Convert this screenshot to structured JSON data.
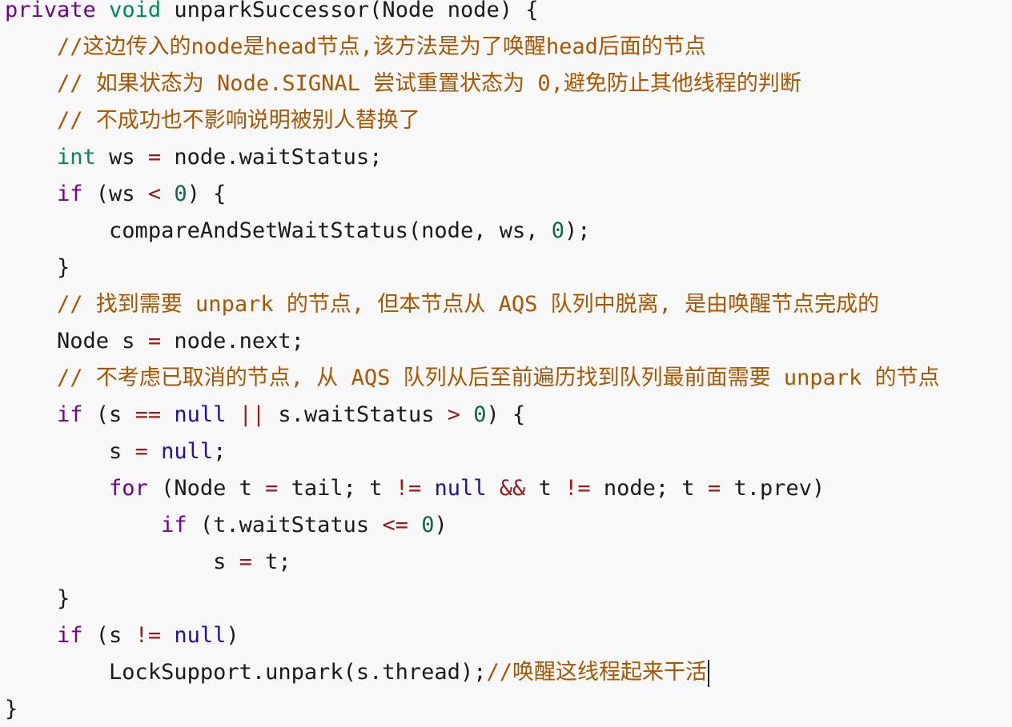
{
  "colors": {
    "background": "#f8f8f8",
    "keyword_purple": "#770088",
    "type_green": "#008855",
    "comment_brown": "#aa5500",
    "operator_pink": "#981a1a",
    "null_navy": "#221199",
    "number_green": "#116644",
    "default_text": "#1a1a1a"
  },
  "code": {
    "lines": [
      {
        "indent": 0,
        "tokens": [
          {
            "text": "private",
            "kind": "kw"
          },
          {
            "text": " ",
            "kind": "plain"
          },
          {
            "text": "void",
            "kind": "type"
          },
          {
            "text": " unparkSuccessor(Node node) {",
            "kind": "plain"
          }
        ]
      },
      {
        "indent": 4,
        "tokens": [
          {
            "text": "//这边传入的node是head节点,该方法是为了唤醒head后面的节点",
            "kind": "comment"
          }
        ]
      },
      {
        "indent": 4,
        "tokens": [
          {
            "text": "// 如果状态为 Node.SIGNAL 尝试重置状态为 0,避免防止其他线程的判断",
            "kind": "comment"
          }
        ]
      },
      {
        "indent": 4,
        "tokens": [
          {
            "text": "// 不成功也不影响说明被别人替换了",
            "kind": "comment"
          }
        ]
      },
      {
        "indent": 4,
        "tokens": [
          {
            "text": "int",
            "kind": "type"
          },
          {
            "text": " ws ",
            "kind": "plain"
          },
          {
            "text": "=",
            "kind": "op"
          },
          {
            "text": " node.waitStatus;",
            "kind": "plain"
          }
        ]
      },
      {
        "indent": 4,
        "tokens": [
          {
            "text": "if",
            "kind": "kw"
          },
          {
            "text": " (ws ",
            "kind": "plain"
          },
          {
            "text": "<",
            "kind": "op"
          },
          {
            "text": " ",
            "kind": "plain"
          },
          {
            "text": "0",
            "kind": "num"
          },
          {
            "text": ") {",
            "kind": "plain"
          }
        ]
      },
      {
        "indent": 8,
        "tokens": [
          {
            "text": "compareAndSetWaitStatus(node, ws, ",
            "kind": "plain"
          },
          {
            "text": "0",
            "kind": "num"
          },
          {
            "text": ");",
            "kind": "plain"
          }
        ]
      },
      {
        "indent": 4,
        "tokens": [
          {
            "text": "}",
            "kind": "plain"
          }
        ]
      },
      {
        "indent": 4,
        "tokens": [
          {
            "text": "// 找到需要 unpark 的节点, 但本节点从 AQS 队列中脱离, 是由唤醒节点完成的",
            "kind": "comment"
          }
        ]
      },
      {
        "indent": 4,
        "tokens": [
          {
            "text": "Node s ",
            "kind": "plain"
          },
          {
            "text": "=",
            "kind": "op"
          },
          {
            "text": " node.next;",
            "kind": "plain"
          }
        ]
      },
      {
        "indent": 4,
        "tokens": [
          {
            "text": "// 不考虑已取消的节点, 从 AQS 队列从后至前遍历找到队列最前面需要 unpark 的节点",
            "kind": "comment"
          }
        ]
      },
      {
        "indent": 4,
        "tokens": [
          {
            "text": "if",
            "kind": "kw"
          },
          {
            "text": " (s ",
            "kind": "plain"
          },
          {
            "text": "==",
            "kind": "op"
          },
          {
            "text": " ",
            "kind": "plain"
          },
          {
            "text": "null",
            "kind": "null"
          },
          {
            "text": " ",
            "kind": "plain"
          },
          {
            "text": "||",
            "kind": "op"
          },
          {
            "text": " s.waitStatus ",
            "kind": "plain"
          },
          {
            "text": ">",
            "kind": "op"
          },
          {
            "text": " ",
            "kind": "plain"
          },
          {
            "text": "0",
            "kind": "num"
          },
          {
            "text": ") {",
            "kind": "plain"
          }
        ]
      },
      {
        "indent": 8,
        "tokens": [
          {
            "text": "s ",
            "kind": "plain"
          },
          {
            "text": "=",
            "kind": "op"
          },
          {
            "text": " ",
            "kind": "plain"
          },
          {
            "text": "null",
            "kind": "null"
          },
          {
            "text": ";",
            "kind": "plain"
          }
        ]
      },
      {
        "indent": 8,
        "tokens": [
          {
            "text": "for",
            "kind": "kw"
          },
          {
            "text": " (Node t ",
            "kind": "plain"
          },
          {
            "text": "=",
            "kind": "op"
          },
          {
            "text": " tail; t ",
            "kind": "plain"
          },
          {
            "text": "!=",
            "kind": "op"
          },
          {
            "text": " ",
            "kind": "plain"
          },
          {
            "text": "null",
            "kind": "null"
          },
          {
            "text": " ",
            "kind": "plain"
          },
          {
            "text": "&&",
            "kind": "op"
          },
          {
            "text": " t ",
            "kind": "plain"
          },
          {
            "text": "!=",
            "kind": "op"
          },
          {
            "text": " node; t ",
            "kind": "plain"
          },
          {
            "text": "=",
            "kind": "op"
          },
          {
            "text": " t.prev)",
            "kind": "plain"
          }
        ]
      },
      {
        "indent": 12,
        "tokens": [
          {
            "text": "if",
            "kind": "kw"
          },
          {
            "text": " (t.waitStatus ",
            "kind": "plain"
          },
          {
            "text": "<=",
            "kind": "op"
          },
          {
            "text": " ",
            "kind": "plain"
          },
          {
            "text": "0",
            "kind": "num"
          },
          {
            "text": ")",
            "kind": "plain"
          }
        ]
      },
      {
        "indent": 16,
        "tokens": [
          {
            "text": "s ",
            "kind": "plain"
          },
          {
            "text": "=",
            "kind": "op"
          },
          {
            "text": " t;",
            "kind": "plain"
          }
        ]
      },
      {
        "indent": 4,
        "tokens": [
          {
            "text": "}",
            "kind": "plain"
          }
        ]
      },
      {
        "indent": 4,
        "tokens": [
          {
            "text": "if",
            "kind": "kw"
          },
          {
            "text": " (s ",
            "kind": "plain"
          },
          {
            "text": "!=",
            "kind": "op"
          },
          {
            "text": " ",
            "kind": "plain"
          },
          {
            "text": "null",
            "kind": "null"
          },
          {
            "text": ")",
            "kind": "plain"
          }
        ]
      },
      {
        "indent": 8,
        "caret": true,
        "tokens": [
          {
            "text": "LockSupport.unpark(s.thread);",
            "kind": "plain"
          },
          {
            "text": "//唤醒这线程起来干活",
            "kind": "comment"
          }
        ]
      },
      {
        "indent": 0,
        "tokens": [
          {
            "text": "}",
            "kind": "plain"
          }
        ]
      }
    ]
  }
}
